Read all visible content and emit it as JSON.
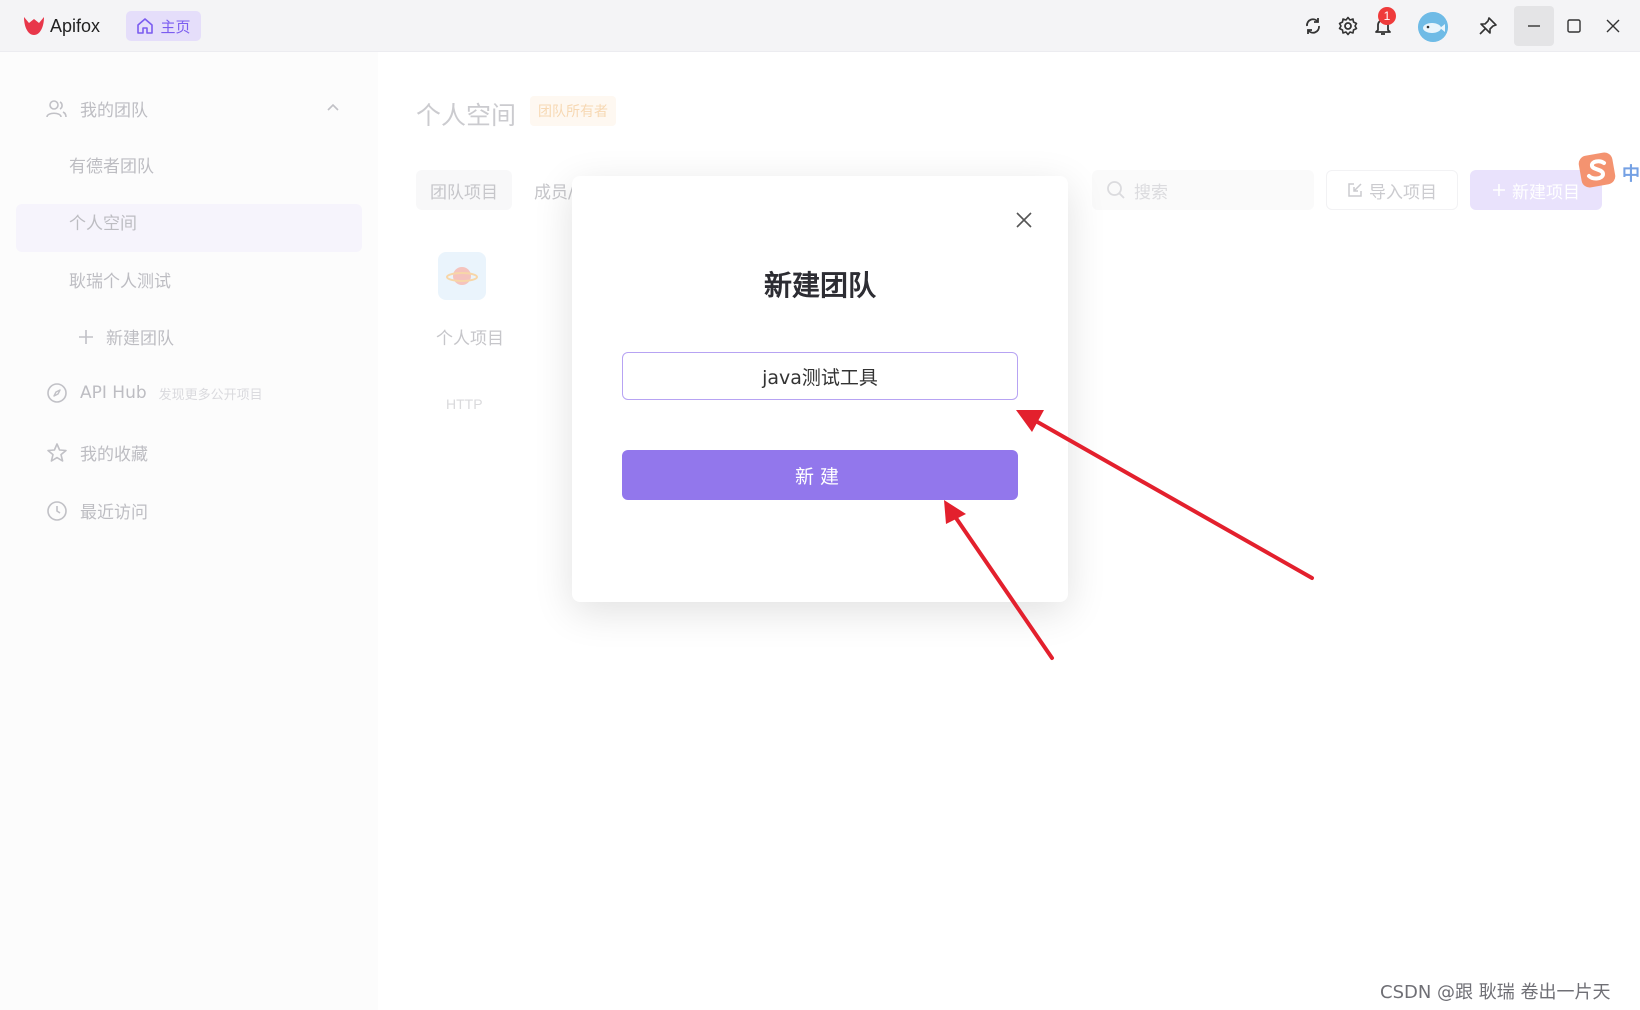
{
  "app": {
    "name": "Apifox",
    "home_tab": "主页",
    "notification_count": "1",
    "brand_color": "#7b5cf0"
  },
  "sidebar": {
    "my_teams": "我的团队",
    "teams": [
      "有德者团队",
      "个人空间",
      "耿瑞个人测试"
    ],
    "active_team": "个人空间",
    "new_team": "新建团队",
    "api_hub": "API Hub",
    "api_hub_desc": "发现更多公开项目",
    "favorites": "我的收藏",
    "recent": "最近访问"
  },
  "main": {
    "title": "个人空间",
    "owner_badge": "团队所有者",
    "tabs": [
      "团队项目",
      "成员/"
    ],
    "search_placeholder": "搜索",
    "import_button": "导入项目",
    "new_project_button": "新建项目",
    "project": {
      "name": "个人项目",
      "type": "HTTP"
    }
  },
  "ime": {
    "label": "中"
  },
  "modal": {
    "title": "新建团队",
    "input_value": "java测试工具",
    "submit_label": "新建"
  },
  "watermark": "CSDN @跟 耿瑞 卷出一片天"
}
